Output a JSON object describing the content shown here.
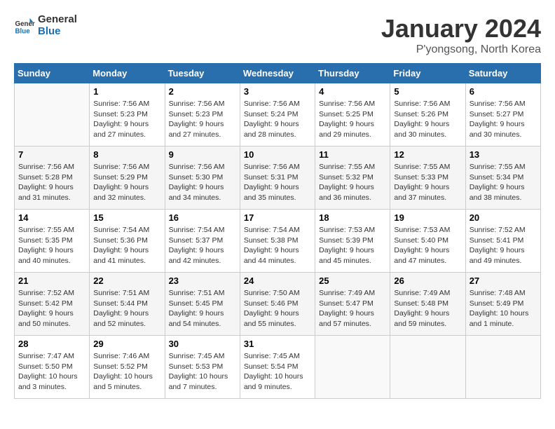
{
  "logo": {
    "line1": "General",
    "line2": "Blue"
  },
  "title": "January 2024",
  "subtitle": "P'yongsong, North Korea",
  "days_header": [
    "Sunday",
    "Monday",
    "Tuesday",
    "Wednesday",
    "Thursday",
    "Friday",
    "Saturday"
  ],
  "weeks": [
    [
      {
        "day": "",
        "content": ""
      },
      {
        "day": "1",
        "content": "Sunrise: 7:56 AM\nSunset: 5:23 PM\nDaylight: 9 hours\nand 27 minutes."
      },
      {
        "day": "2",
        "content": "Sunrise: 7:56 AM\nSunset: 5:23 PM\nDaylight: 9 hours\nand 27 minutes."
      },
      {
        "day": "3",
        "content": "Sunrise: 7:56 AM\nSunset: 5:24 PM\nDaylight: 9 hours\nand 28 minutes."
      },
      {
        "day": "4",
        "content": "Sunrise: 7:56 AM\nSunset: 5:25 PM\nDaylight: 9 hours\nand 29 minutes."
      },
      {
        "day": "5",
        "content": "Sunrise: 7:56 AM\nSunset: 5:26 PM\nDaylight: 9 hours\nand 30 minutes."
      },
      {
        "day": "6",
        "content": "Sunrise: 7:56 AM\nSunset: 5:27 PM\nDaylight: 9 hours\nand 30 minutes."
      }
    ],
    [
      {
        "day": "7",
        "content": "Sunrise: 7:56 AM\nSunset: 5:28 PM\nDaylight: 9 hours\nand 31 minutes."
      },
      {
        "day": "8",
        "content": "Sunrise: 7:56 AM\nSunset: 5:29 PM\nDaylight: 9 hours\nand 32 minutes."
      },
      {
        "day": "9",
        "content": "Sunrise: 7:56 AM\nSunset: 5:30 PM\nDaylight: 9 hours\nand 34 minutes."
      },
      {
        "day": "10",
        "content": "Sunrise: 7:56 AM\nSunset: 5:31 PM\nDaylight: 9 hours\nand 35 minutes."
      },
      {
        "day": "11",
        "content": "Sunrise: 7:55 AM\nSunset: 5:32 PM\nDaylight: 9 hours\nand 36 minutes."
      },
      {
        "day": "12",
        "content": "Sunrise: 7:55 AM\nSunset: 5:33 PM\nDaylight: 9 hours\nand 37 minutes."
      },
      {
        "day": "13",
        "content": "Sunrise: 7:55 AM\nSunset: 5:34 PM\nDaylight: 9 hours\nand 38 minutes."
      }
    ],
    [
      {
        "day": "14",
        "content": "Sunrise: 7:55 AM\nSunset: 5:35 PM\nDaylight: 9 hours\nand 40 minutes."
      },
      {
        "day": "15",
        "content": "Sunrise: 7:54 AM\nSunset: 5:36 PM\nDaylight: 9 hours\nand 41 minutes."
      },
      {
        "day": "16",
        "content": "Sunrise: 7:54 AM\nSunset: 5:37 PM\nDaylight: 9 hours\nand 42 minutes."
      },
      {
        "day": "17",
        "content": "Sunrise: 7:54 AM\nSunset: 5:38 PM\nDaylight: 9 hours\nand 44 minutes."
      },
      {
        "day": "18",
        "content": "Sunrise: 7:53 AM\nSunset: 5:39 PM\nDaylight: 9 hours\nand 45 minutes."
      },
      {
        "day": "19",
        "content": "Sunrise: 7:53 AM\nSunset: 5:40 PM\nDaylight: 9 hours\nand 47 minutes."
      },
      {
        "day": "20",
        "content": "Sunrise: 7:52 AM\nSunset: 5:41 PM\nDaylight: 9 hours\nand 49 minutes."
      }
    ],
    [
      {
        "day": "21",
        "content": "Sunrise: 7:52 AM\nSunset: 5:42 PM\nDaylight: 9 hours\nand 50 minutes."
      },
      {
        "day": "22",
        "content": "Sunrise: 7:51 AM\nSunset: 5:44 PM\nDaylight: 9 hours\nand 52 minutes."
      },
      {
        "day": "23",
        "content": "Sunrise: 7:51 AM\nSunset: 5:45 PM\nDaylight: 9 hours\nand 54 minutes."
      },
      {
        "day": "24",
        "content": "Sunrise: 7:50 AM\nSunset: 5:46 PM\nDaylight: 9 hours\nand 55 minutes."
      },
      {
        "day": "25",
        "content": "Sunrise: 7:49 AM\nSunset: 5:47 PM\nDaylight: 9 hours\nand 57 minutes."
      },
      {
        "day": "26",
        "content": "Sunrise: 7:49 AM\nSunset: 5:48 PM\nDaylight: 9 hours\nand 59 minutes."
      },
      {
        "day": "27",
        "content": "Sunrise: 7:48 AM\nSunset: 5:49 PM\nDaylight: 10 hours\nand 1 minute."
      }
    ],
    [
      {
        "day": "28",
        "content": "Sunrise: 7:47 AM\nSunset: 5:50 PM\nDaylight: 10 hours\nand 3 minutes."
      },
      {
        "day": "29",
        "content": "Sunrise: 7:46 AM\nSunset: 5:52 PM\nDaylight: 10 hours\nand 5 minutes."
      },
      {
        "day": "30",
        "content": "Sunrise: 7:45 AM\nSunset: 5:53 PM\nDaylight: 10 hours\nand 7 minutes."
      },
      {
        "day": "31",
        "content": "Sunrise: 7:45 AM\nSunset: 5:54 PM\nDaylight: 10 hours\nand 9 minutes."
      },
      {
        "day": "",
        "content": ""
      },
      {
        "day": "",
        "content": ""
      },
      {
        "day": "",
        "content": ""
      }
    ]
  ]
}
